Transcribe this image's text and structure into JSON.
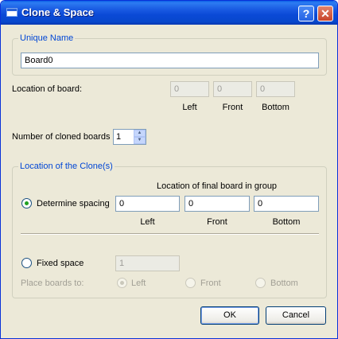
{
  "window": {
    "title": "Clone & Space"
  },
  "unique_name": {
    "legend": "Unique Name",
    "value": "Board0"
  },
  "location_of_board": {
    "label": "Location of board:",
    "left_value": "0",
    "front_value": "0",
    "bottom_value": "0",
    "left_label": "Left",
    "front_label": "Front",
    "bottom_label": "Bottom"
  },
  "cloned": {
    "label": "Number of cloned boards",
    "value": "1"
  },
  "clone_location": {
    "legend": "Location of the Clone(s)",
    "final_board_label": "Location of final board in group",
    "determine_spacing_label": "Determine spacing",
    "left_value": "0",
    "front_value": "0",
    "bottom_value": "0",
    "left_label": "Left",
    "front_label": "Front",
    "bottom_label": "Bottom",
    "fixed_space_label": "Fixed space",
    "fixed_space_value": "1",
    "place_boards_label": "Place boards to:",
    "place_left": "Left",
    "place_front": "Front",
    "place_bottom": "Bottom"
  },
  "buttons": {
    "ok": "OK",
    "cancel": "Cancel"
  },
  "colors": {
    "titlebar": "#0a49d6",
    "legend": "#0046d5",
    "radio_check": "#21a121"
  }
}
